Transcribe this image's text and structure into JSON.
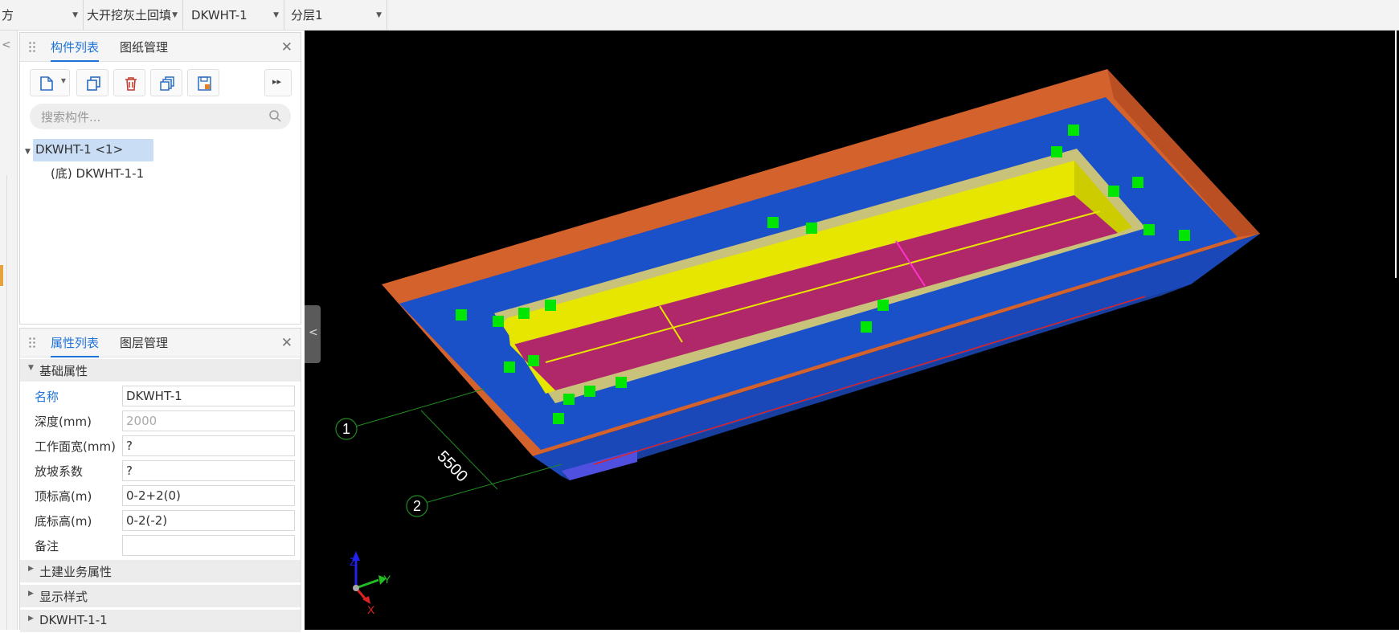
{
  "toolbar": {
    "combo_type": "方",
    "combo_component": "大开挖灰土回填",
    "combo_name": "DKWHT-1",
    "combo_layer": "分层1"
  },
  "component_panel": {
    "tab_list": "构件列表",
    "tab_drawings": "图纸管理",
    "search_placeholder": "搜索构件...",
    "tree_root": "DKWHT-1 <1>",
    "tree_child": "(底) DKWHT-1-1"
  },
  "property_panel": {
    "tab_props": "属性列表",
    "tab_layers": "图层管理",
    "section_basic": "基础属性",
    "rows": [
      {
        "name": "名称",
        "value": "DKWHT-1"
      },
      {
        "name": "深度(mm)",
        "value": "2000"
      },
      {
        "name": "工作面宽(mm)",
        "value": "?"
      },
      {
        "name": "放坡系数",
        "value": "?"
      },
      {
        "name": "顶标高(m)",
        "value": "0-2+2(0)"
      },
      {
        "name": "底标高(m)",
        "value": "0-2(-2)"
      },
      {
        "name": "备注",
        "value": ""
      }
    ],
    "section_civil": "土建业务属性",
    "section_display": "显示样式",
    "section_sub": "DKWHT-1-1"
  },
  "viewport": {
    "axis_1": "1",
    "axis_2": "2",
    "dimension": "5500",
    "gizmo_z": "Z",
    "gizmo_y": "Y",
    "gizmo_x": "X"
  },
  "colors": {
    "accent": "#1e73d9",
    "soil_top": "#d4622c",
    "soil_face": "#1a50c8",
    "pit_wall": "#e6e600",
    "pit_floor": "#b0276a",
    "grip": "#00e600"
  }
}
